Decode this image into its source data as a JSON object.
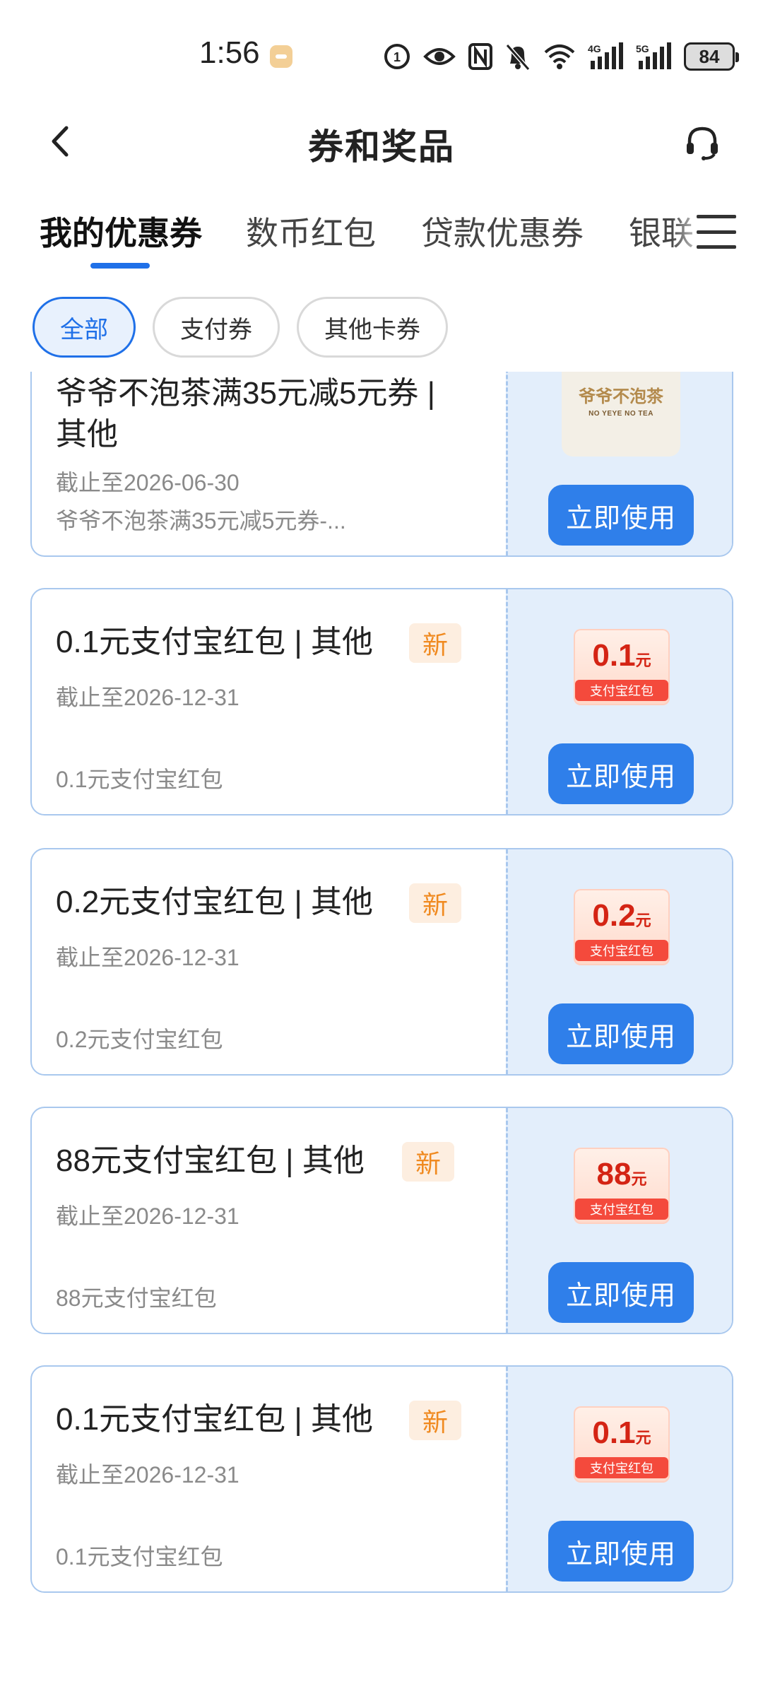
{
  "status_bar": {
    "time": "1:56",
    "battery": "84",
    "network_4g": "4G",
    "network_5g": "5G"
  },
  "header": {
    "title": "券和奖品"
  },
  "tabs": [
    {
      "label": "我的优惠券",
      "active": true
    },
    {
      "label": "数币红包",
      "active": false
    },
    {
      "label": "贷款优惠券",
      "active": false
    },
    {
      "label": "银联",
      "active": false
    }
  ],
  "filters": [
    {
      "label": "全部",
      "active": true
    },
    {
      "label": "支付券",
      "active": false
    },
    {
      "label": "其他卡券",
      "active": false
    }
  ],
  "coupons": [
    {
      "title": "爷爷不泡茶满35元减5元券 | 其他",
      "expiry": "截止至2026-06-30",
      "description": "爷爷不泡茶满35元减5元券-...",
      "new": false,
      "button": "立即使用",
      "logo_cn": "爷爷不泡茶",
      "logo_en": "NO YEYE NO TEA"
    },
    {
      "title": "0.1元支付宝红包 | 其他",
      "badge": "新",
      "expiry": "截止至2026-12-31",
      "description": "0.1元支付宝红包",
      "button": "立即使用",
      "thumb_amount": "0.1",
      "thumb_unit": "元",
      "thumb_label": "支付宝红包"
    },
    {
      "title": "0.2元支付宝红包 | 其他",
      "badge": "新",
      "expiry": "截止至2026-12-31",
      "description": "0.2元支付宝红包",
      "button": "立即使用",
      "thumb_amount": "0.2",
      "thumb_unit": "元",
      "thumb_label": "支付宝红包"
    },
    {
      "title": "88元支付宝红包 | 其他",
      "badge": "新",
      "expiry": "截止至2026-12-31",
      "description": "88元支付宝红包",
      "button": "立即使用",
      "thumb_amount": "88",
      "thumb_unit": "元",
      "thumb_label": "支付宝红包"
    },
    {
      "title": "0.1元支付宝红包 | 其他",
      "badge": "新",
      "expiry": "截止至2026-12-31",
      "description": "0.1元支付宝红包",
      "button": "立即使用",
      "thumb_amount": "0.1",
      "thumb_unit": "元",
      "thumb_label": "支付宝红包"
    }
  ],
  "colors": {
    "accent": "#1f70e8",
    "button": "#2f7fea",
    "card_border": "#a9c8ee",
    "card_right_bg": "#e3eefb",
    "badge_bg": "#fdeee0",
    "badge_text": "#f08a20",
    "redpacket": "#d42414"
  }
}
